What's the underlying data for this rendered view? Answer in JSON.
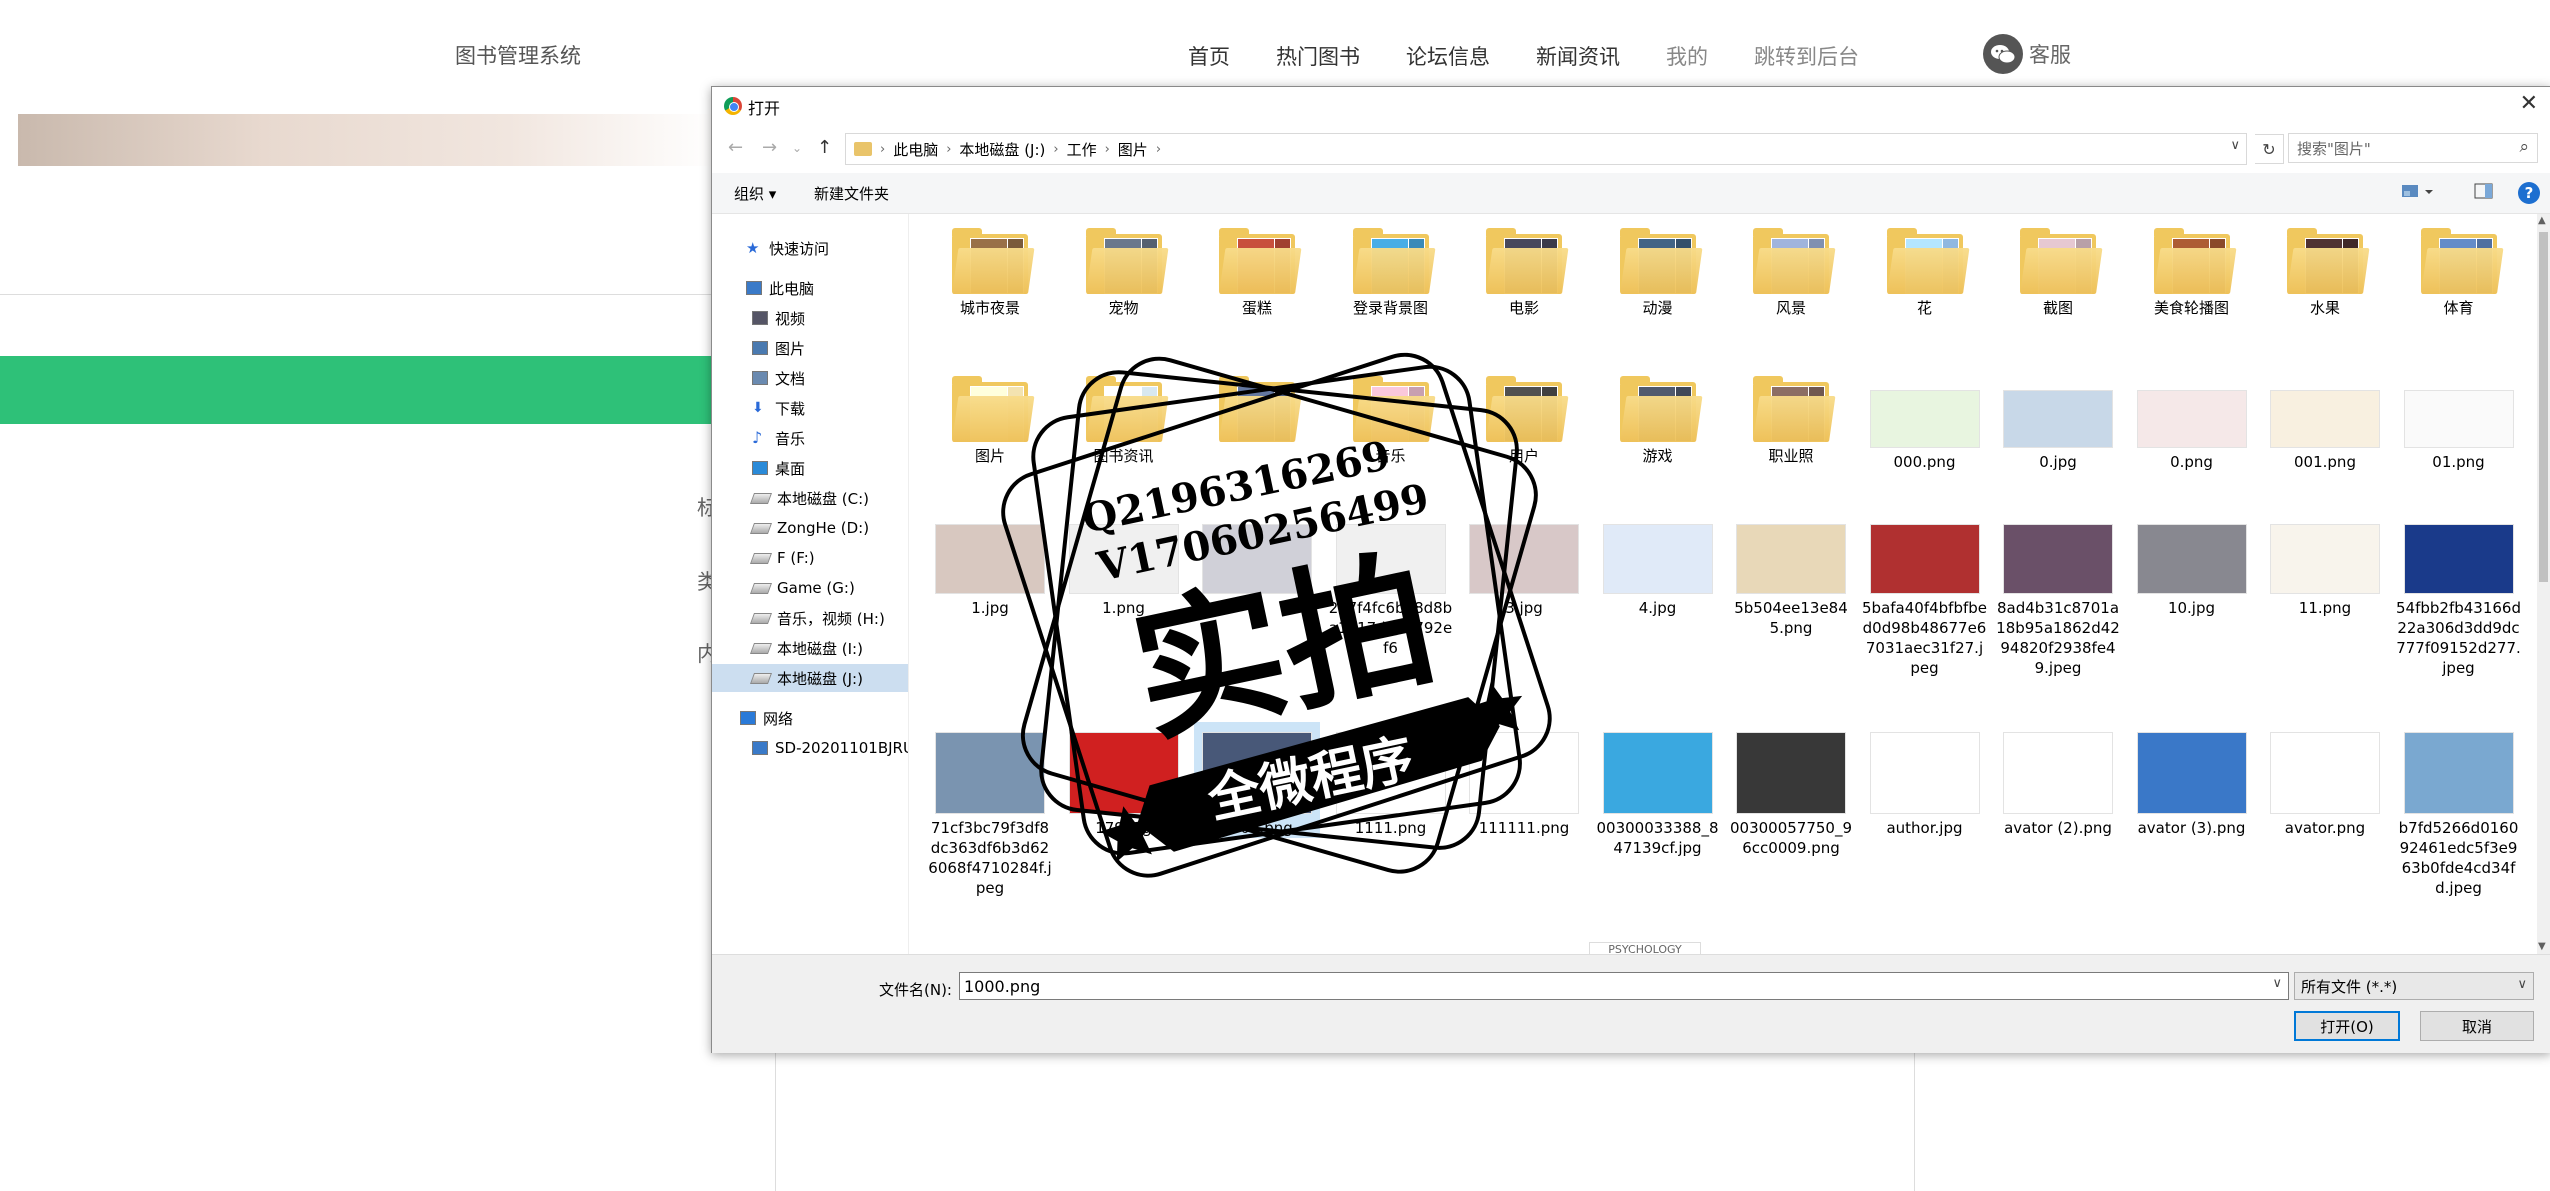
{
  "site": {
    "logo": "图书管理系统",
    "nav": [
      "首页",
      "热门图书",
      "论坛信息",
      "新闻资讯",
      "我的",
      "跳转到后台"
    ],
    "service": "客服",
    "side_labels": [
      "标",
      "类",
      "内"
    ]
  },
  "dialog": {
    "title": "打开",
    "path": [
      "此电脑",
      "本地磁盘 (J:)",
      "工作",
      "图片"
    ],
    "search_placeholder": "搜索\"图片\"",
    "toolbar": {
      "organize": "组织 ▾",
      "new_folder": "新建文件夹"
    },
    "tree": [
      {
        "label": "快速访问",
        "icon": "star-icon"
      },
      {
        "label": "此电脑",
        "icon": "computer-icon"
      },
      {
        "label": "视频",
        "icon": "video-icon"
      },
      {
        "label": "图片",
        "icon": "pictures-icon"
      },
      {
        "label": "文档",
        "icon": "documents-icon"
      },
      {
        "label": "下载",
        "icon": "download-icon"
      },
      {
        "label": "音乐",
        "icon": "music-icon"
      },
      {
        "label": "桌面",
        "icon": "desktop-icon"
      },
      {
        "label": "本地磁盘 (C:)",
        "icon": "drive-icon"
      },
      {
        "label": "ZongHe (D:)",
        "icon": "drive-icon"
      },
      {
        "label": "F (F:)",
        "icon": "drive-icon"
      },
      {
        "label": "Game (G:)",
        "icon": "drive-icon"
      },
      {
        "label": "音乐，视频 (H:)",
        "icon": "drive-icon"
      },
      {
        "label": "本地磁盘 (I:)",
        "icon": "drive-icon"
      },
      {
        "label": "本地磁盘 (J:)",
        "icon": "drive-icon"
      },
      {
        "label": "网络",
        "icon": "network-icon"
      },
      {
        "label": "SD-20201101BJRU",
        "icon": "computer-icon"
      }
    ],
    "files": [
      {
        "name": "城市夜景",
        "kind": "folder",
        "color": "#7a5a3a"
      },
      {
        "name": "宠物",
        "kind": "folder",
        "color": "#556070"
      },
      {
        "name": "蛋糕",
        "kind": "folder",
        "color": "#a04030"
      },
      {
        "name": "登录背景图",
        "kind": "folder",
        "color": "#3a8ab8"
      },
      {
        "name": "电影",
        "kind": "folder",
        "color": "#3a3a4a"
      },
      {
        "name": "动漫",
        "kind": "folder",
        "color": "#34506a"
      },
      {
        "name": "风景",
        "kind": "folder",
        "color": "#8090b0"
      },
      {
        "name": "花",
        "kind": "folder",
        "color": "#90b8e0"
      },
      {
        "name": "截图",
        "kind": "folder",
        "color": "#b8a0a8"
      },
      {
        "name": "美食轮播图",
        "kind": "folder",
        "color": "#8a4a2a"
      },
      {
        "name": "水果",
        "kind": "folder",
        "color": "#402828"
      },
      {
        "name": "体育",
        "kind": "folder",
        "color": "#5070a0"
      },
      {
        "name": "图片",
        "kind": "folder",
        "color": "#f3e3b0"
      },
      {
        "name": "图书资讯",
        "kind": "folder",
        "color": "#d8e8f0"
      },
      {
        "name": "",
        "kind": "folder",
        "color": "#506080"
      },
      {
        "name": "音乐",
        "kind": "folder",
        "color": "#c8a0b0"
      },
      {
        "name": "用户",
        "kind": "folder",
        "color": "#404040"
      },
      {
        "name": "游戏",
        "kind": "folder",
        "color": "#404858"
      },
      {
        "name": "职业照",
        "kind": "folder",
        "color": "#705850"
      },
      {
        "name": "000.png",
        "kind": "image",
        "color": "#e8f5e0"
      },
      {
        "name": "0.jpg",
        "kind": "image",
        "color": "#c8d8e8"
      },
      {
        "name": "0.png",
        "kind": "image",
        "color": "#f5e8e8"
      },
      {
        "name": "001.png",
        "kind": "image",
        "color": "#f8f0e0"
      },
      {
        "name": "01.png",
        "kind": "image",
        "color": "#fafafa"
      },
      {
        "name": "1.jpg",
        "kind": "image",
        "color": "#d8c8c0"
      },
      {
        "name": "1.png",
        "kind": "image",
        "color": "#f0f0f0"
      },
      {
        "name": "",
        "kind": "image",
        "color": "#d0d0d8"
      },
      {
        "name": "2e7f4fc6b28d8ba1717d551792ef6",
        "kind": "image",
        "color": "#f0f0f0"
      },
      {
        "name": "3.jpg",
        "kind": "image",
        "color": "#d8c8c8"
      },
      {
        "name": "4.jpg",
        "kind": "image",
        "color": "#e0eaf8"
      },
      {
        "name": "5b504ee13e845.png",
        "kind": "image",
        "color": "#e8d8b8"
      },
      {
        "name": "5bafa40f4bfbfbed0d98b48677e67031aec31f27.jpeg",
        "kind": "image",
        "color": "#b03030"
      },
      {
        "name": "8ad4b31c8701a18b95a1862d4294820f2938fe49.jpeg",
        "kind": "image",
        "color": "#6a5068"
      },
      {
        "name": "10.jpg",
        "kind": "image",
        "color": "#888890"
      },
      {
        "name": "11.png",
        "kind": "image",
        "color": "#f8f4ec"
      },
      {
        "name": "54fbb2fb43166d22a306d3dd9dc777f09152d277.jpeg",
        "kind": "image",
        "color": "#1a3a8a"
      },
      {
        "name": "71cf3bc79f3df8dc363df6b3d626068f4710284f.jpeg",
        "kind": "image",
        "color": "#7a94b0"
      },
      {
        "name": "179.jpg",
        "kind": "image",
        "color": "#d02020"
      },
      {
        "name": "1000.png",
        "kind": "image",
        "color": "#485878"
      },
      {
        "name": "1111.png",
        "kind": "image",
        "color": "#ffffff"
      },
      {
        "name": "111111.png",
        "kind": "image",
        "color": "#ffffff"
      },
      {
        "name": "00300033388_847139cf.jpg",
        "kind": "image",
        "color": "#3aa8e0"
      },
      {
        "name": "00300057750_96cc0009.png",
        "kind": "image",
        "color": "#383838"
      },
      {
        "name": "author.jpg",
        "kind": "image",
        "color": "#ffffff"
      },
      {
        "name": "avator (2).png",
        "kind": "image",
        "color": "#ffffff"
      },
      {
        "name": "avator (3).png",
        "kind": "image",
        "color": "#3a78c8"
      },
      {
        "name": "avator.png",
        "kind": "image",
        "color": "#ffffff"
      },
      {
        "name": "b7fd5266d016092461edc5f3e963b0fde4cd34fd.jpeg",
        "kind": "image",
        "color": "#7aa8d0"
      }
    ],
    "partial_row_text": "PSYCHOLOGY",
    "filename_label": "文件名(N):",
    "filename_value": "1000.png",
    "filetype": "所有文件 (*.*)",
    "open_label": "打开(O)",
    "cancel_label": "取消"
  },
  "watermark": {
    "line1": "Q2196316269",
    "line2": "V17060256499",
    "main": "实拍",
    "ribbon": "全微程序"
  }
}
